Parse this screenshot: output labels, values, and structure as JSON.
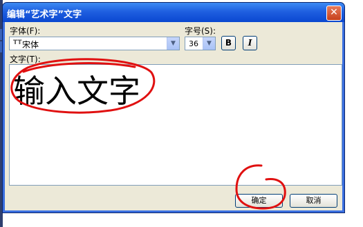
{
  "window": {
    "title": "编辑“艺术字”文字",
    "close_glyph": "✕"
  },
  "font": {
    "label": "字体(F):",
    "value": "宋体",
    "type_glyph": "TT"
  },
  "size": {
    "label": "字号(S):",
    "value": "36"
  },
  "format": {
    "bold_label": "B",
    "italic_label": "I"
  },
  "text": {
    "label": "文字(T):",
    "value": "输入文字"
  },
  "buttons": {
    "ok": "确定",
    "cancel": "取消"
  },
  "colors": {
    "title_bar": "#0a47d0",
    "annotation": "#e01010",
    "dialog_face": "#ece9d8"
  },
  "icons": {
    "dropdown": "chevron-down-icon",
    "close": "close-icon"
  }
}
